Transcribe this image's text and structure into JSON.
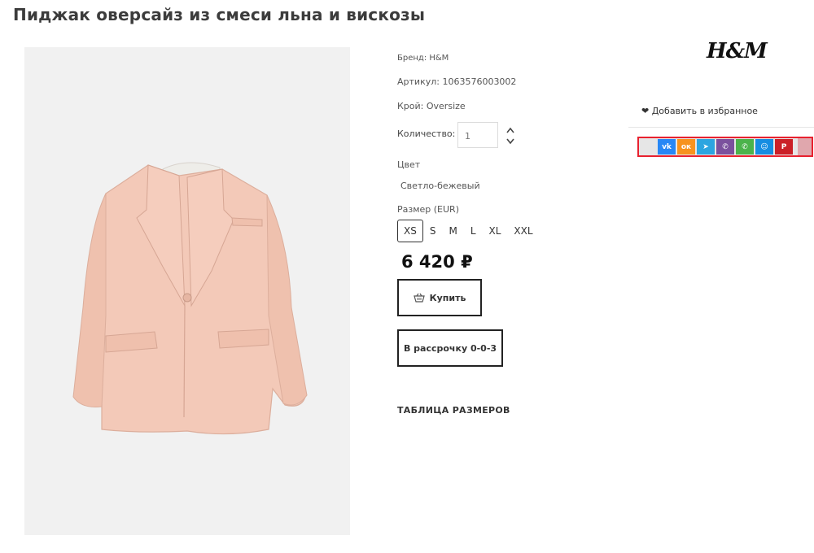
{
  "product": {
    "title": "Пиджак оверсайз из смеси льна и вискозы",
    "brand_logo": "H&M",
    "brand": "Бренд: H&M",
    "article": "Артикул: 1063576003002",
    "cut": "Крой: Oversize",
    "quantity_label": "Количество:",
    "quantity_value": "1",
    "color_label": "Цвет",
    "color_value": "Светло-бежевый",
    "size_label": "Размер (EUR)",
    "sizes": [
      "XS",
      "S",
      "M",
      "L",
      "XL",
      "XXL"
    ],
    "selected_size": "XS",
    "price": "6 420 ₽",
    "buy_label": "Купить",
    "installment_label": "В рассрочку 0-0-3",
    "size_table_label": "ТАБЛИЦА РАЗМЕРОВ",
    "favorite_label": "❤ Добавить в избранное"
  },
  "share": [
    {
      "name": "vk",
      "glyph": "vk",
      "color": "#2787f5"
    },
    {
      "name": "odnoklassniki",
      "glyph": "ок",
      "color": "#f7931e"
    },
    {
      "name": "telegram",
      "glyph": "➤",
      "color": "#2ca5e0"
    },
    {
      "name": "viber",
      "glyph": "✆",
      "color": "#7b519d"
    },
    {
      "name": "whatsapp",
      "glyph": "✆",
      "color": "#4bb34b"
    },
    {
      "name": "moimir",
      "glyph": "☺",
      "color": "#168de2"
    },
    {
      "name": "pinterest",
      "glyph": "P",
      "color": "#cb2027"
    }
  ],
  "colors": {
    "jacket": "#f3c9b8",
    "jacket_shade": "#e4b09e",
    "share_border": "#e8212f"
  }
}
